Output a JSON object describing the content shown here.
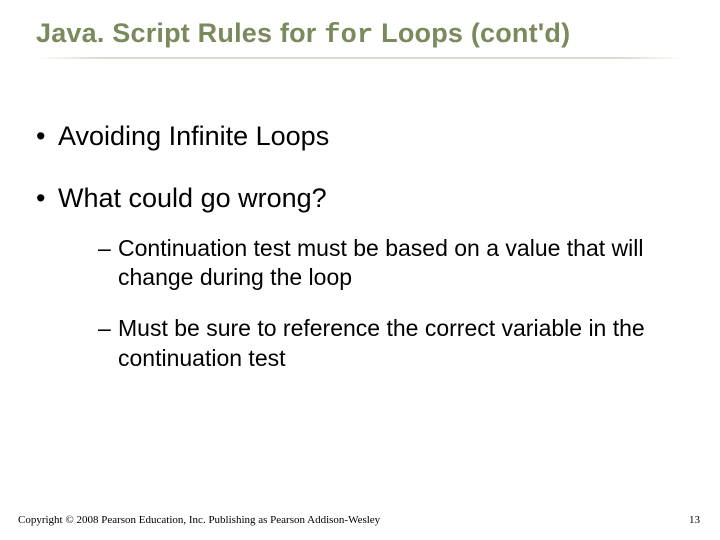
{
  "title": {
    "part1": "Java. Script Rules for ",
    "code": "for",
    "part2": " Loops (cont'd)"
  },
  "bullets": [
    {
      "text": "Avoiding Infinite Loops"
    },
    {
      "text": "What could go wrong?",
      "sub": [
        {
          "text": "Continuation test must be based on a value that will change during the loop"
        },
        {
          "text": "Must be sure to reference the correct variable in the continuation test"
        }
      ]
    }
  ],
  "footer": "Copyright © 2008 Pearson Education, Inc. Publishing as Pearson Addison-Wesley",
  "page_number": "13"
}
